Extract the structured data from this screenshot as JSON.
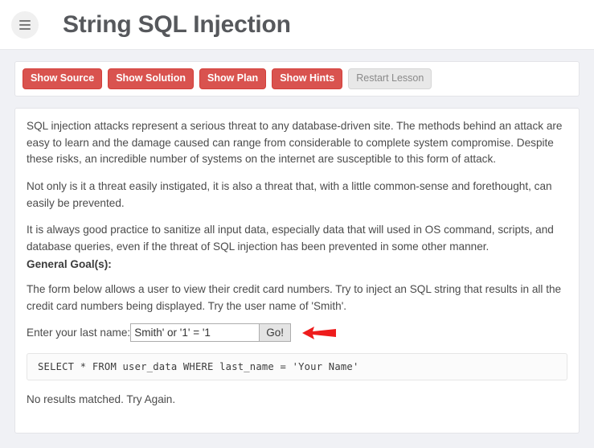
{
  "header": {
    "menu_icon": "hamburger-icon",
    "title": "String SQL Injection"
  },
  "toolbar": {
    "buttons": [
      {
        "label": "Show Source",
        "style": "danger"
      },
      {
        "label": "Show Solution",
        "style": "danger"
      },
      {
        "label": "Show Plan",
        "style": "danger"
      },
      {
        "label": "Show Hints",
        "style": "danger"
      },
      {
        "label": "Restart Lesson",
        "style": "muted"
      }
    ]
  },
  "lesson": {
    "paragraph1": "SQL injection attacks represent a serious threat to any database-driven site. The methods behind an attack are easy to learn and the damage caused can range from considerable to complete system compromise. Despite these risks, an incredible number of systems on the internet are susceptible to this form of attack.",
    "paragraph2": "Not only is it a threat easily instigated, it is also a threat that, with a little common-sense and forethought, can easily be prevented.",
    "paragraph3": "It is always good practice to sanitize all input data, especially data that will used in OS command, scripts, and database queries, even if the threat of SQL injection has been prevented in some other manner.",
    "goal_heading": "General Goal(s):",
    "goal_text": "The form below allows a user to view their credit card numbers. Try to inject an SQL string that results in all the credit card numbers being displayed. Try the user name of 'Smith'.",
    "form": {
      "label": "Enter your last name:",
      "input_value": "Smith' or '1' = '1",
      "input_placeholder": "Your Name",
      "submit_label": "Go!",
      "annotation_icon": "red-arrow-icon"
    },
    "query": "SELECT * FROM user_data WHERE last_name = 'Your Name'",
    "result_message": "No results matched. Try Again."
  },
  "colors": {
    "danger": "#d9534f",
    "muted": "#e8e8e8",
    "page_background": "#f0f1f5",
    "panel": "#ffffff",
    "arrow": "#ee1c1c"
  }
}
